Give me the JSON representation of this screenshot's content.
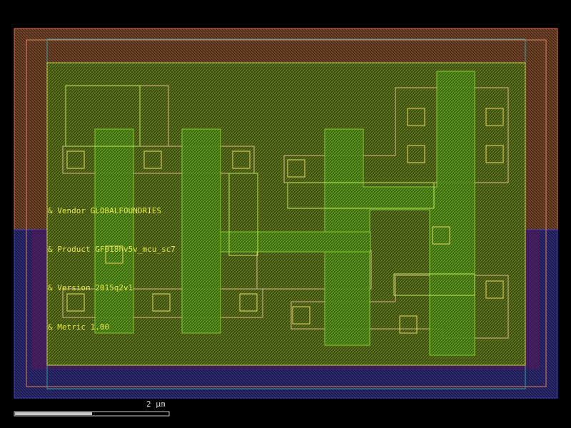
{
  "layout_view": {
    "labels": {
      "vendor": "& Vendor GLOBALFOUNDRIES",
      "product": "& Product GF018hv5v_mcu_sc7",
      "version": "& Version 2015q2v1",
      "metric": "& Metric 1.00"
    },
    "scale_bar": {
      "label": "2 µm"
    }
  }
}
